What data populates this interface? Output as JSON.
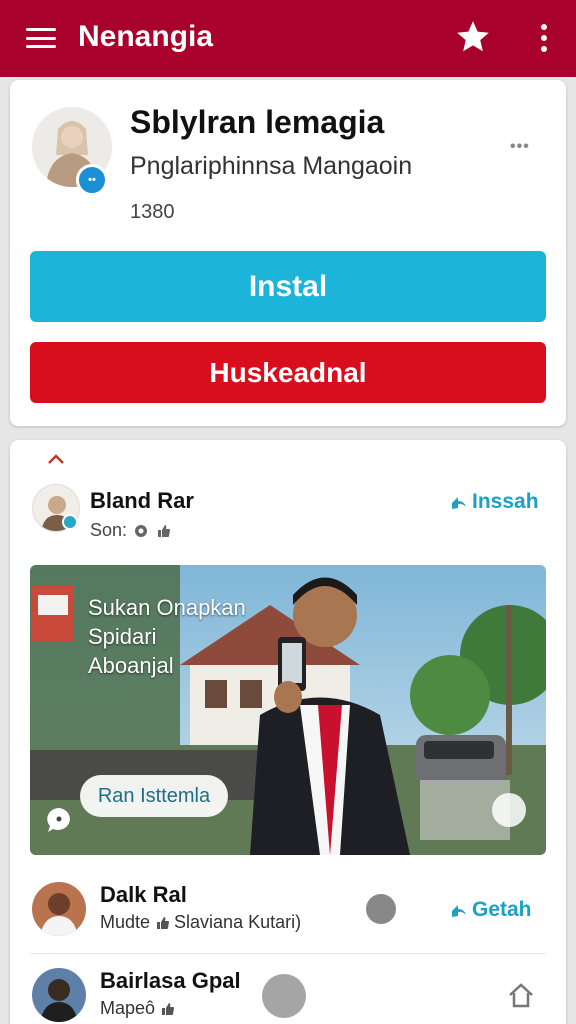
{
  "app_bar": {
    "title": "Nenangia",
    "menu_icon": "hamburger-icon",
    "star_icon": "star-icon",
    "more_icon": "kebab-icon",
    "color": "#a8012b"
  },
  "profile": {
    "name": "Sblylran lemagia",
    "subtitle": "Pnglariphinnsa Mangaoin",
    "count": "1380",
    "more_label": "•••",
    "install_label": "Instal",
    "secondary_label": "Huskeadnal",
    "install_color": "#1cb4d8",
    "secondary_color": "#d90e1d"
  },
  "feed": {
    "post": {
      "author": "Bland Rar",
      "meta": "Son:",
      "action_label": "Inssah",
      "overlay_lines": [
        "Sukan Onapkan",
        "Spidari",
        "Aboanjal"
      ],
      "overlay_pill": "Ran Isttemla"
    },
    "list": [
      {
        "name": "Dalk Ral",
        "sub": "Mudte",
        "sub2": "Slaviana Kutari)",
        "action": "Getah"
      },
      {
        "name": "Bairlasa Gpal",
        "sub": "Mapeô"
      }
    ]
  },
  "accent_color": "#1aa2c4"
}
